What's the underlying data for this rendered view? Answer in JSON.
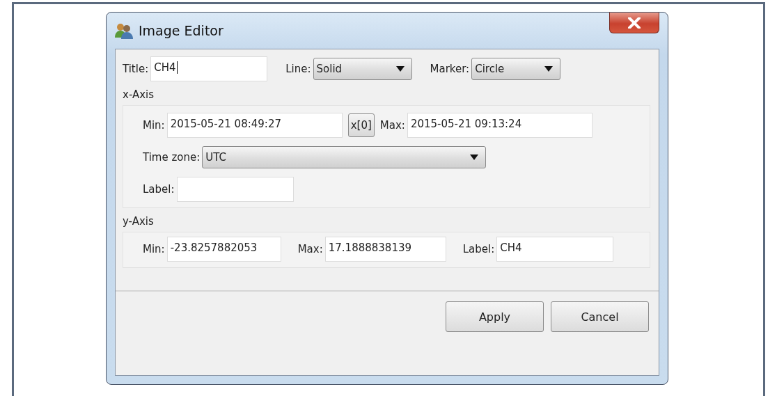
{
  "window": {
    "title": "Image Editor"
  },
  "top_row": [
    {
      "kind": "input",
      "label": "Title:",
      "value": "CH4",
      "focused": true
    },
    {
      "kind": "select",
      "label": "Line:",
      "value": "Solid"
    },
    {
      "kind": "select",
      "label": "Marker:",
      "value": "Circle"
    }
  ],
  "x_axis": {
    "heading": "x-Axis",
    "rows": [
      [
        {
          "kind": "input",
          "label": "Min:",
          "value": "2015-05-21 08:49:27",
          "focused": false
        },
        {
          "kind": "button",
          "value": "x[0]"
        },
        {
          "kind": "input",
          "label": "Max:",
          "value": "2015-05-21 09:13:24",
          "focused": false
        }
      ],
      [
        {
          "kind": "select",
          "label": "Time zone:",
          "value": "UTC"
        }
      ],
      [
        {
          "kind": "input",
          "label": "Label:",
          "focused": false
        }
      ]
    ]
  },
  "y_axis": {
    "heading": "y-Axis",
    "rows": [
      [
        {
          "kind": "input",
          "label": "Min:",
          "value": "-23.8257882053",
          "focused": false
        },
        {
          "kind": "input",
          "label": "Max:",
          "value": "17.1888838139",
          "focused": false
        },
        {
          "kind": "input",
          "label": "Label:",
          "value": "CH4",
          "focused": false
        }
      ]
    ]
  },
  "buttons": [
    "Apply",
    "Cancel"
  ]
}
